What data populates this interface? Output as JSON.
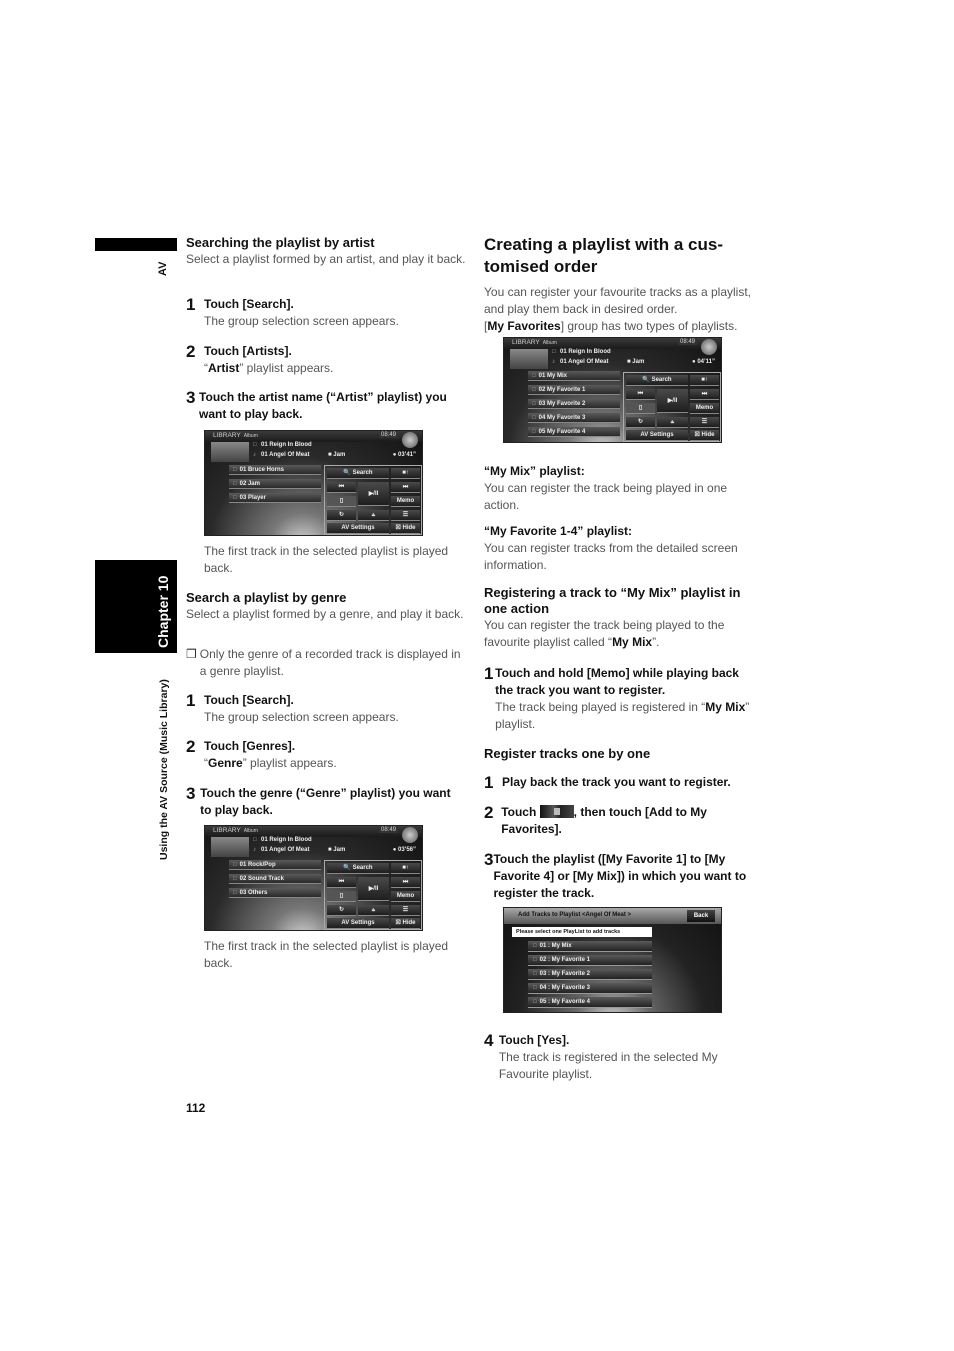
{
  "side": {
    "section_tag": "AV",
    "chapter": "Chapter 10",
    "chapter_title": "Using the AV Source (Music Library)"
  },
  "left": {
    "artist": {
      "heading": "Searching the playlist by artist",
      "intro": "Select a playlist formed by an artist, and play it back.",
      "steps": [
        {
          "num": "1",
          "text": "Touch [Search].",
          "sub": "The group selection screen appears."
        },
        {
          "num": "2",
          "text": "Touch [Artists].",
          "sub_bold": "Artist",
          "sub_rest": "” playlist appears.",
          "sub_open": "“"
        },
        {
          "num": "3",
          "text": "Touch the artist name (“Artist” playlist) you want to play back."
        }
      ],
      "screen": {
        "library": "LIBRARY",
        "category": "Album",
        "time": "08:49",
        "album": "01 Reign In Blood",
        "track": "01 Angel Of Meat",
        "artist": "Jam",
        "duration": "03’41”",
        "list": [
          "01 Bruce Horns",
          "02 Jam",
          "03 Player"
        ],
        "buttons": {
          "search": "Search",
          "prev": "⏮",
          "play": "▶/II",
          "next": "⏭",
          "memo": "Memo",
          "repeat": "↻",
          "random": "⫨",
          "menu": "☰",
          "up": "■↑",
          "av_settings": "AV Settings",
          "hide": "Hide"
        }
      },
      "after": "The first track in the selected playlist is played back."
    },
    "genre": {
      "heading": "Search a playlist by genre",
      "intro": "Select a playlist formed by a genre, and play it back.",
      "note": "Only the genre of a recorded track is displayed in a genre playlist.",
      "note_mark": "❒",
      "steps": [
        {
          "num": "1",
          "text": "Touch [Search].",
          "sub": "The group selection screen appears."
        },
        {
          "num": "2",
          "text": "Touch [Genres].",
          "sub_open": "“",
          "sub_bold": "Genre",
          "sub_rest": "” playlist appears."
        },
        {
          "num": "3",
          "text": "Touch the genre (“Genre” playlist) you want to play back."
        }
      ],
      "screen": {
        "library": "LIBRARY",
        "category": "Album",
        "time": "08:49",
        "album": "01 Reign In Blood",
        "track": "01 Angel Of Meat",
        "artist": "Jam",
        "duration": "03’56”",
        "list": [
          "01 Rock/Pop",
          "02 Sound Track",
          "03 Others"
        ],
        "buttons": {
          "search": "Search",
          "prev": "⏮",
          "play": "▶/II",
          "next": "⏭",
          "memo": "Memo",
          "repeat": "↻",
          "random": "⫨",
          "menu": "☰",
          "up": "■↑",
          "av_settings": "AV Settings",
          "hide": "Hide"
        }
      },
      "after": "The first track in the selected playlist is played back."
    }
  },
  "right": {
    "heading": "Creating a playlist with a customised order",
    "heading_line1": "Creating a playlist with a cus-",
    "heading_line2": "tomised order",
    "intro": "You can register your favourite tracks as a playlist, and play them back in desired order.",
    "group_bold": "My Favorites",
    "group_rest": "] group has two types of playlists.",
    "screen": {
      "library": "LIBRARY",
      "category": "Album",
      "time": "08:49",
      "album": "01 Reign In Blood",
      "track": "01 Angel Of Meat",
      "artist": "Jam",
      "duration": "04’11”",
      "list": [
        "01 My Mix",
        "02 My Favorite 1",
        "03 My Favorite 2",
        "04 My Favorite 3",
        "05 My Favorite 4"
      ],
      "buttons": {
        "search": "Search",
        "prev": "⏮",
        "play": "▶/II",
        "next": "⏭",
        "memo": "Memo",
        "repeat": "↻",
        "random": "⫨",
        "menu": "☰",
        "up": "■↑",
        "av_settings": "AV Settings",
        "hide": "Hide"
      }
    },
    "mymix": {
      "title": "“My Mix” playlist:",
      "text": "You can register the track being played in one action."
    },
    "myfav": {
      "title": "“My Favorite 1-4” playlist:",
      "text": "You can register tracks from the detailed screen information."
    },
    "register_one": {
      "heading": "Registering a track to “My Mix” playlist in one action",
      "intro_pre": "You can register the track being played to the favourite playlist called “",
      "intro_bold": "My Mix",
      "intro_post": "”.",
      "step": {
        "num": "1",
        "text": "Touch and hold [Memo] while playing back the track you want to register.",
        "sub_pre": "The track being played is registered in “",
        "sub_bold": "My Mix",
        "sub_post": "” playlist."
      }
    },
    "register_each": {
      "heading": "Register tracks one by one",
      "steps": [
        {
          "num": "1",
          "text": "Play back the track you want to register."
        },
        {
          "num": "2",
          "text_pre": "Touch",
          "text_post": ", then touch [Add to My Favorites]."
        },
        {
          "num": "3",
          "text": "Touch the playlist ([My Favorite 1] to [My Favorite 4] or [My Mix]) in which you want to register the track."
        },
        {
          "num": "4",
          "text": "Touch [Yes].",
          "sub": "The track is registered in the selected My Favourite playlist."
        }
      ],
      "screen": {
        "title": "Add Tracks to Playlist <Angel Of Meat >",
        "back": "Back",
        "prompt": "Please select one PlayList to add tracks",
        "list": [
          "01 : My Mix",
          "02 : My Favorite 1",
          "03 : My Favorite 2",
          "04 : My Favorite 3",
          "05 : My Favorite 4"
        ]
      }
    }
  },
  "page_number": "112"
}
